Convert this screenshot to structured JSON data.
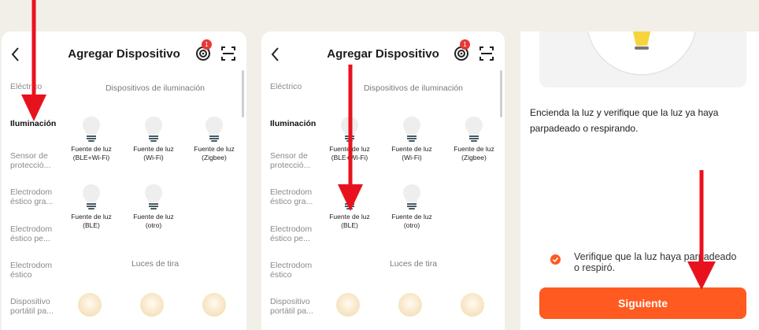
{
  "panels": [
    {
      "title": "Agregar Dispositivo",
      "badge": "1",
      "categories": [
        "Eléctrico",
        "Iluminación",
        "Sensor de protecció...",
        "Electrodom éstico gra...",
        "Electrodom éstico pe...",
        "Electrodom éstico",
        "Dispositivo portátil pa..."
      ],
      "active_category": "Iluminación",
      "section_lighting": "Dispositivos de iluminación",
      "devices": [
        "Fuente de luz (BLE+Wi-Fi)",
        "Fuente de luz (Wi-Fi)",
        "Fuente de luz (Zigbee)",
        "Fuente de luz (BLE)",
        "Fuente de luz (otro)"
      ],
      "section_strips": "Luces de tira"
    },
    {
      "title": "Agregar Dispositivo",
      "badge": "1",
      "categories": [
        "Eléctrico",
        "Iluminación",
        "Sensor de protecció...",
        "Electrodom éstico gra...",
        "Electrodom éstico pe...",
        "Electrodom éstico",
        "Dispositivo portátil pa..."
      ],
      "active_category": "Iluminación",
      "section_lighting": "Dispositivos de iluminación",
      "devices": [
        "Fuente de luz (BLE+Wi-Fi)",
        "Fuente de luz (Wi-Fi)",
        "Fuente de luz (Zigbee)",
        "Fuente de luz (BLE)",
        "Fuente de luz (otro)"
      ],
      "section_strips": "Luces de tira"
    }
  ],
  "confirm": {
    "instruction": "Encienda la luz y verifique que la luz ya haya parpadeado o respirando.",
    "checkbox_label": "Verifique que la luz haya parpadeado o respiró.",
    "checkbox_checked": true,
    "next_button": "Siguiente"
  },
  "colors": {
    "accent": "#ff5a1f",
    "arrow": "#e8121e",
    "badge": "#e53935"
  },
  "icons": [
    "back-icon",
    "target-icon",
    "scan-icon",
    "bulb-icon",
    "strip-light-icon",
    "check-icon",
    "lamp-icon"
  ]
}
